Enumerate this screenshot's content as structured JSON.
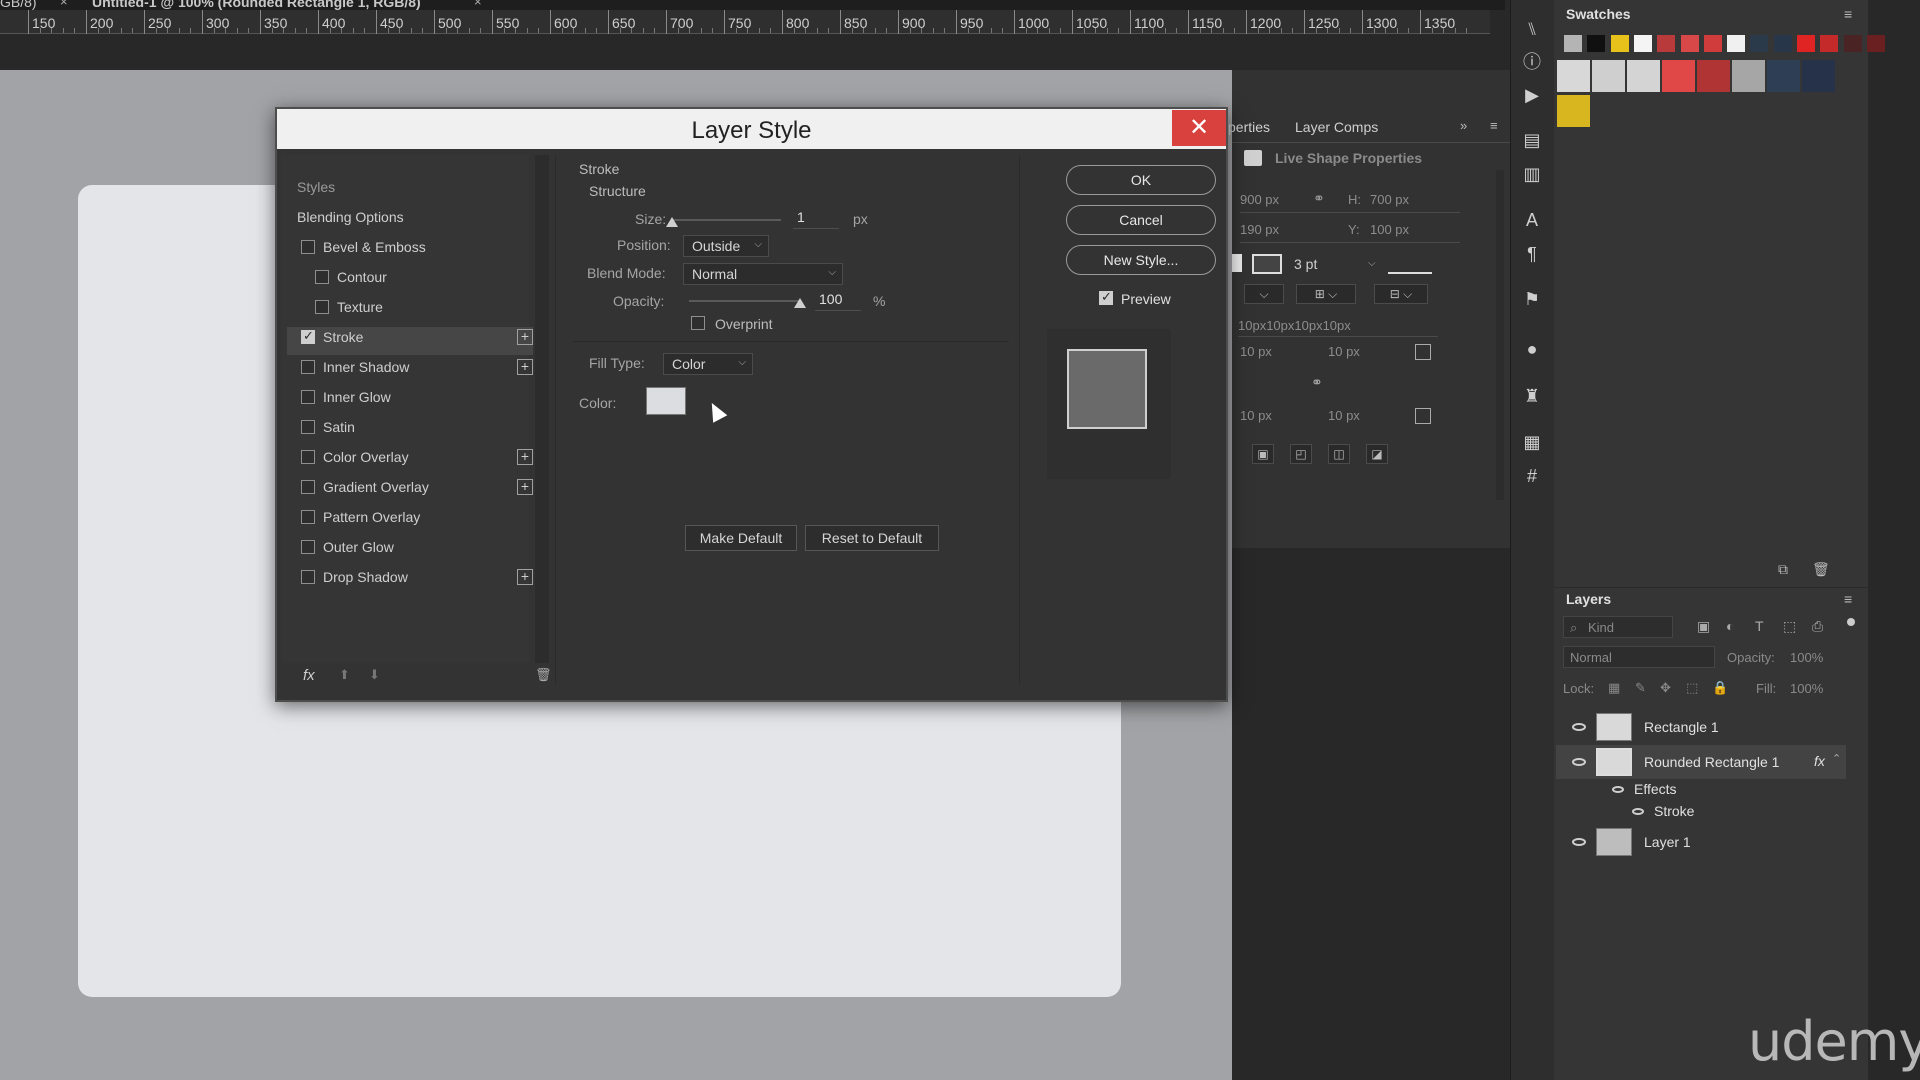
{
  "document": {
    "tab_prefix": "GB/8)",
    "tab_title": "Untitled-1 @ 100% (Rounded Rectangle 1, RGB/8)",
    "tab_close": "×",
    "ruler_labels": [
      "150",
      "200",
      "250",
      "300",
      "350",
      "400",
      "450",
      "500",
      "550",
      "600",
      "650",
      "700",
      "750",
      "800",
      "850",
      "900",
      "950",
      "1000",
      "1050",
      "1100",
      "1150",
      "1200",
      "1250",
      "1300",
      "1350"
    ]
  },
  "dialog": {
    "title": "Layer Style",
    "close_label": "✕",
    "styles_header": "Styles",
    "blending_options": "Blending Options",
    "styles": [
      {
        "label": "Bevel & Emboss",
        "checked": false,
        "plus": false,
        "indent": false
      },
      {
        "label": "Contour",
        "checked": false,
        "plus": false,
        "indent": true
      },
      {
        "label": "Texture",
        "checked": false,
        "plus": false,
        "indent": true
      },
      {
        "label": "Stroke",
        "checked": true,
        "plus": true,
        "indent": false
      },
      {
        "label": "Inner Shadow",
        "checked": false,
        "plus": true,
        "indent": false
      },
      {
        "label": "Inner Glow",
        "checked": false,
        "plus": false,
        "indent": false
      },
      {
        "label": "Satin",
        "checked": false,
        "plus": false,
        "indent": false
      },
      {
        "label": "Color Overlay",
        "checked": false,
        "plus": true,
        "indent": false
      },
      {
        "label": "Gradient Overlay",
        "checked": false,
        "plus": true,
        "indent": false
      },
      {
        "label": "Pattern Overlay",
        "checked": false,
        "plus": false,
        "indent": false
      },
      {
        "label": "Outer Glow",
        "checked": false,
        "plus": false,
        "indent": false
      },
      {
        "label": "Drop Shadow",
        "checked": false,
        "plus": true,
        "indent": false
      }
    ],
    "footer": {
      "fx": "fx",
      "up": "⬆",
      "down": "⬇",
      "trash": "🗑"
    },
    "stroke": {
      "section": "Stroke",
      "structure": "Structure",
      "size_label": "Size:",
      "size_value": "1",
      "size_unit": "px",
      "position_label": "Position:",
      "position_value": "Outside",
      "blend_label": "Blend Mode:",
      "blend_value": "Normal",
      "opacity_label": "Opacity:",
      "opacity_value": "100",
      "opacity_unit": "%",
      "overprint_label": "Overprint",
      "fill_type_label": "Fill Type:",
      "fill_type_value": "Color",
      "color_label": "Color:",
      "make_default": "Make Default",
      "reset_default": "Reset to Default"
    },
    "buttons": {
      "ok": "OK",
      "cancel": "Cancel",
      "new_style": "New Style...",
      "preview": "Preview"
    }
  },
  "properties": {
    "tab_properties": "perties",
    "tab_layer_comps": "Layer Comps",
    "live_shape": "Live Shape Properties",
    "w_value": "900 px",
    "h_label": "H:",
    "h_value": "700 px",
    "x_value": "190 px",
    "y_label": "Y:",
    "y_value": "100 px",
    "stroke_width": "3 pt",
    "corner_summary": "10px10px10px10px",
    "corner_tl": "10 px",
    "corner_tr": "10 px",
    "corner_bl": "10 px",
    "corner_br": "10 px"
  },
  "swatches": {
    "title": "Swatches",
    "row1": [
      "#b4b4b4",
      "#101010",
      "#e6c21a",
      "#f4f4f4",
      "#b83a3a",
      "#d84848",
      "#d03c3c",
      "#f0f0f0",
      "#2b3a4a",
      "#28364a",
      "#e02424",
      "#c42a2a",
      "#4a2424",
      "#6a2020"
    ],
    "row2": [
      "#d8d8d8",
      "#cfcfcf",
      "#d4d4d4",
      "#e04848",
      "#b03434",
      "#a6a6a6",
      "#2e3e55",
      "#26324a"
    ],
    "row3": [
      "#d8b620"
    ]
  },
  "layers": {
    "title": "Layers",
    "kind_placeholder": "Kind",
    "blend_mode": "Normal",
    "opacity_label": "Opacity:",
    "opacity_value": "100%",
    "lock_label": "Lock:",
    "fill_label": "Fill:",
    "fill_value": "100%",
    "items": [
      {
        "name": "Rectangle 1"
      },
      {
        "name": "Rounded Rectangle 1",
        "fx": "fx"
      },
      {
        "name": "Effects"
      },
      {
        "name": "Stroke"
      },
      {
        "name": "Layer 1"
      }
    ]
  },
  "watermark": "udemy"
}
